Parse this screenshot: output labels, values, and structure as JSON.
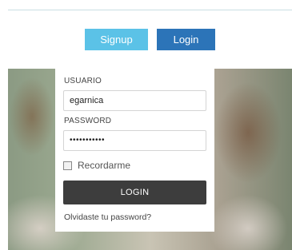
{
  "tabs": {
    "signup_label": "Signup",
    "login_label": "Login"
  },
  "form": {
    "username_label": "USUARIO",
    "username_value": "egarnica",
    "password_label": "PASSWORD",
    "password_value": "•••••••••••",
    "remember_label": "Recordarme",
    "remember_checked": false,
    "submit_label": "LOGIN",
    "forgot_label": "Olvidaste tu password?"
  },
  "colors": {
    "signup": "#5bc2e7",
    "login_tab": "#2c74b8",
    "submit": "#3d3d3d"
  }
}
